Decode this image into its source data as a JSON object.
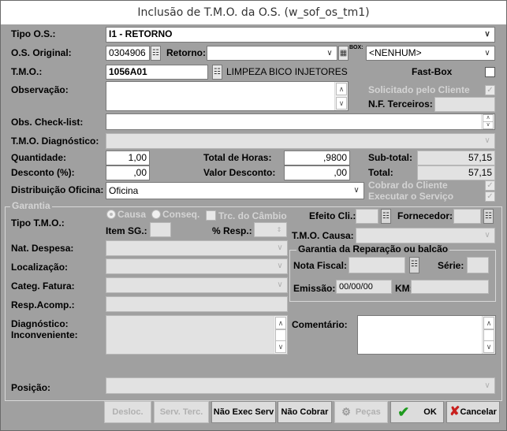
{
  "window": {
    "title": "Inclusão de T.M.O. da O.S. (w_sof_os_tm1)"
  },
  "tipo_os": {
    "label": "Tipo O.S.:",
    "value": "I1 - RETORNO"
  },
  "os_original": {
    "label": "O.S. Original:",
    "value": "0304906"
  },
  "retorno": {
    "label": "Retorno:",
    "value": ""
  },
  "box": {
    "label": "BOX:",
    "value": "<NENHUM>"
  },
  "tmo": {
    "label": "T.M.O.:",
    "code": "1056A01",
    "description": "LIMPEZA BICO INJETORES"
  },
  "fast_box": {
    "label": "Fast-Box",
    "checked": false
  },
  "observacao": {
    "label": "Observação:",
    "value": ""
  },
  "solicitado_cliente": {
    "label": "Solicitado pelo Cliente",
    "checked": true
  },
  "nf_terceiros": {
    "label": "N.F. Terceiros:",
    "value": ""
  },
  "obs_checklist": {
    "label": "Obs. Check-list:",
    "value": ""
  },
  "tmo_diagnostico": {
    "label": "T.M.O. Diagnóstico:",
    "value": ""
  },
  "quantidade": {
    "label": "Quantidade:",
    "value": "1,00"
  },
  "total_horas": {
    "label": "Total de Horas:",
    "value": ",9800"
  },
  "subtotal": {
    "label": "Sub-total:",
    "value": "57,15"
  },
  "desconto_pct": {
    "label": "Desconto (%):",
    "value": ",00"
  },
  "valor_desconto": {
    "label": "Valor Desconto:",
    "value": ",00"
  },
  "total": {
    "label": "Total:",
    "value": "57,15"
  },
  "distribuicao": {
    "label": "Distribuição Oficina:",
    "value": "Oficina"
  },
  "cobrar_cliente": {
    "label": "Cobrar do Cliente",
    "checked": true
  },
  "executar_servico": {
    "label": "Executar o Serviço",
    "checked": true
  },
  "garantia": {
    "title": "Garantia",
    "tipo_tmo_label": "Tipo T.M.O.:",
    "causa_label": "Causa",
    "conseq_label": "Conseq.",
    "trc_cambio_label": "Trc. do Câmbio",
    "efeito_cli_label": "Efeito Cli.:",
    "fornecedor_label": "Fornecedor:",
    "item_sg_label": "Item SG.:",
    "pct_resp_label": "% Resp.:",
    "tmo_causa_label": "T.M.O. Causa:",
    "nat_despesa_label": "Nat. Despesa:",
    "localizacao_label": "Localização:",
    "categ_fatura_label": "Categ. Fatura:",
    "resp_acomp_label": "Resp.Acomp.:",
    "diagnostico_label": "Diagnóstico:",
    "inconveniente_label": "Inconveniente:",
    "comentario_label": "Comentário:"
  },
  "reparacao": {
    "title": "Garantia da Reparação ou balcão",
    "nota_fiscal_label": "Nota Fiscal:",
    "serie_label": "Série:",
    "emissao_label": "Emissão:",
    "emissao_value": "00/00/00",
    "km_label": "KM:"
  },
  "posicao": {
    "label": "Posição:",
    "value": ""
  },
  "buttons": {
    "desloc": "Desloc.",
    "serv_terc": "Serv. Terc.",
    "nao_exec_serv": "Não Exec Serv",
    "nao_cobrar": "Não Cobrar",
    "pecas": "Peças",
    "ok": "OK",
    "cancelar": "Cancelar"
  },
  "icons": {
    "dropdown": "chevron-down-icon",
    "lookup": "lookup-icon",
    "folder": "folder-icon",
    "pecas": "parts-icon",
    "ok": "checkmark-icon",
    "cancel": "x-icon"
  },
  "colors": {
    "form_bg": "#a0a0a0",
    "ok_green": "#1e9a1e",
    "cancel_red": "#c8201e"
  }
}
